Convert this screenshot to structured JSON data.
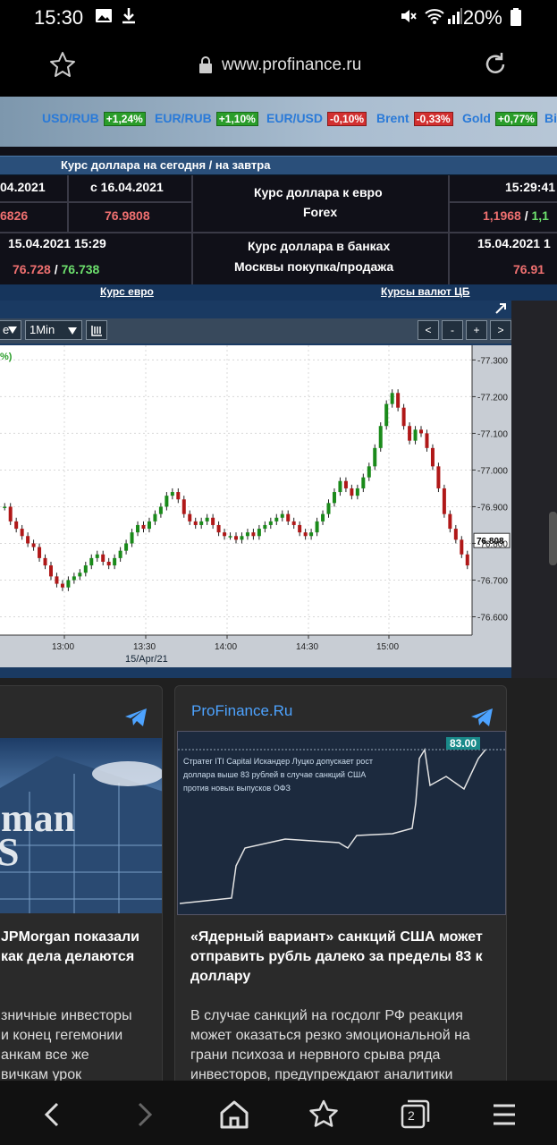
{
  "status_bar": {
    "time": "15:30",
    "battery": "20%"
  },
  "browser": {
    "url": "www.profinance.ru"
  },
  "ticker": [
    {
      "name": "USD/RUB",
      "change": "+1,24%",
      "dir": "up"
    },
    {
      "name": "EUR/RUB",
      "change": "+1,10%",
      "dir": "up"
    },
    {
      "name": "EUR/USD",
      "change": "-0,10%",
      "dir": "down"
    },
    {
      "name": "Brent",
      "change": "-0,33%",
      "dir": "down"
    },
    {
      "name": "Gold",
      "change": "+0,77%",
      "dir": "up"
    },
    {
      "name": "Bi",
      "change": "",
      "dir": ""
    }
  ],
  "rates": {
    "header": "Курс доллара на сегодня / на завтра",
    "date_today": "04.2021",
    "date_tomorrow": "с 16.04.2021",
    "val_today": "6826",
    "val_tomorrow": "76.9808",
    "usd_eur_label": "Курс доллара к евро",
    "usd_eur_sub": "Forex",
    "forex_time": "15:29:41",
    "forex_val_a": "1,1968",
    "forex_sep": "/",
    "forex_val_b": "1,1",
    "bank_time": "15.04.2021 15:29",
    "bank_buy": "76.728",
    "bank_sep": "/",
    "bank_sell": "76.738",
    "bank_label_1": "Курс доллара в банках",
    "bank_label_2": "Москвы покупка/продажа",
    "bank_right_time": "15.04.2021 1",
    "bank_right_val": "76.91"
  },
  "links": {
    "left": "Курс евро",
    "right": "Курсы валют ЦБ"
  },
  "chart_toolbar": {
    "left_sel": "e",
    "interval": "1Min",
    "prev": "<",
    "minus": "-",
    "plus": "+",
    "next": ">"
  },
  "chart_data": {
    "type": "line",
    "title": "",
    "corner_text": "%)",
    "xlabel": "15/Apr/21",
    "ylabel": "",
    "x_ticks": [
      "13:00",
      "13:30",
      "14:00",
      "14:30",
      "15:00"
    ],
    "y_ticks": [
      "77.300",
      "77.200",
      "77.100",
      "77.000",
      "76.900",
      "76.800",
      "76.700",
      "76.600"
    ],
    "last_value": "76.808",
    "ylim": [
      76.55,
      77.34
    ],
    "series": [
      {
        "values": [
          76.9,
          76.86,
          76.84,
          76.82,
          76.8,
          76.79,
          76.76,
          76.74,
          76.71,
          76.69,
          76.68,
          76.7,
          76.71,
          76.72,
          76.74,
          76.76,
          76.77,
          76.75,
          76.74,
          76.76,
          76.78,
          76.8,
          76.83,
          76.85,
          76.84,
          76.86,
          76.88,
          76.9,
          76.93,
          76.94,
          76.92,
          76.88,
          76.86,
          76.85,
          76.86,
          76.87,
          76.85,
          76.83,
          76.82,
          76.82,
          76.81,
          76.82,
          76.83,
          76.82,
          76.84,
          76.85,
          76.86,
          76.87,
          76.88,
          76.86,
          76.85,
          76.83,
          76.82,
          76.83,
          76.86,
          76.88,
          76.91,
          76.94,
          76.97,
          76.95,
          76.93,
          76.95,
          76.98,
          77.01,
          77.06,
          77.12,
          77.18,
          77.21,
          77.17,
          77.12,
          77.08,
          77.11,
          77.1,
          77.06,
          77.01,
          76.95,
          76.88,
          76.84,
          76.81,
          76.77,
          76.74
        ]
      }
    ]
  },
  "news": [
    {
      "source": "",
      "headline_1": "JPMorgan показали",
      "headline_2": "как дела делаются",
      "body": [
        "зничные инвесторы",
        "и конец гегемонии",
        "анкам все же",
        "вичкам урок"
      ],
      "image_text_1": "man",
      "image_text_2": "S"
    },
    {
      "source": "ProFinance.Ru",
      "image_caption": "Стратег ITI Capital Искандер Луцко допускает рост доллара выше 83 рублей в случае санкций США против новых выпусков ОФЗ",
      "image_value": "83.00",
      "headline": "«Ядерный вариант» санкций США может отправить рубль далеко за пределы 83 к доллару",
      "body": "В случае санкций на госдолг РФ реакция может оказаться резко эмоциональной на грани психоза и нервного срыва ряда инвесторов, предупреждают аналитики"
    }
  ],
  "bottom_nav": {
    "tabs_count": "2"
  }
}
